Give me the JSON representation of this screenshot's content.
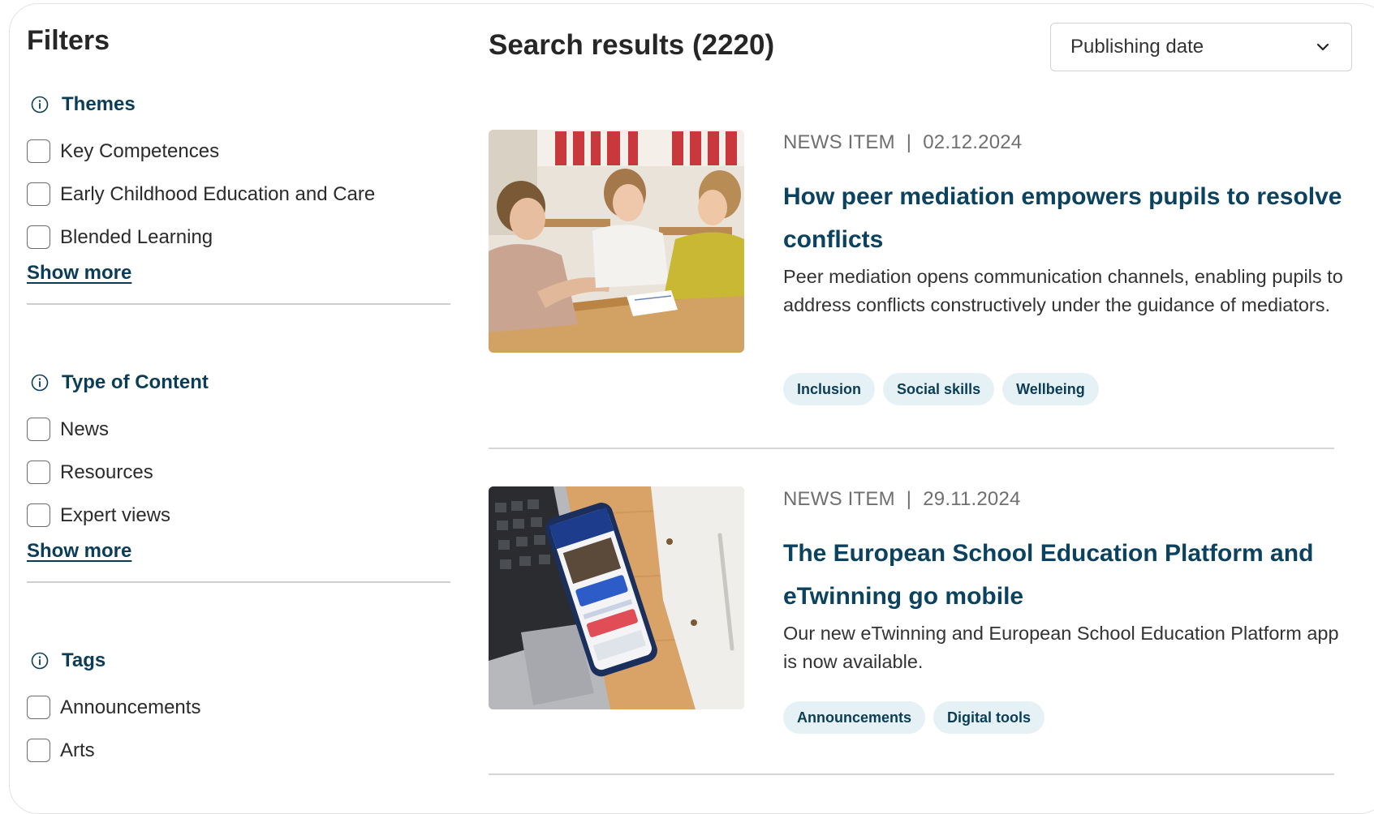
{
  "sidebar": {
    "title": "Filters",
    "groups": [
      {
        "title": "Themes",
        "options": [
          "Key Competences",
          "Early Childhood Education and Care",
          "Blended Learning"
        ],
        "show_more": "Show more"
      },
      {
        "title": "Type of Content",
        "options": [
          "News",
          "Resources",
          "Expert views"
        ],
        "show_more": "Show more"
      },
      {
        "title": "Tags",
        "options": [
          "Announcements",
          "Arts"
        ]
      }
    ]
  },
  "main": {
    "results_title": "Search results (2220)",
    "sort": {
      "selected": "Publishing date"
    },
    "results": [
      {
        "type": "NEWS ITEM",
        "separator": "|",
        "date": "02.12.2024",
        "title": "How peer mediation empowers pupils to resolve conflicts",
        "summary": "Peer mediation opens communication channels, enabling pupils to address conflicts constructively under the guidance of mediators.",
        "tags": [
          "Inclusion",
          "Social skills",
          "Wellbeing"
        ],
        "image": "classroom-photo"
      },
      {
        "type": "NEWS ITEM",
        "separator": "|",
        "date": "29.11.2024",
        "title": "The European School Education Platform and eTwinning go mobile",
        "summary": "Our new eTwinning and European School Education Platform app is now available.",
        "tags": [
          "Announcements",
          "Digital tools"
        ],
        "image": "smartphone-laptop-photo"
      }
    ]
  },
  "colors": {
    "heading": "#0b3d56",
    "link": "#0b4260",
    "tag_bg": "#e6f1f6",
    "meta": "#6f6f6f"
  },
  "icons": {
    "info": "info-icon",
    "sort": "chevron-down-icon"
  }
}
